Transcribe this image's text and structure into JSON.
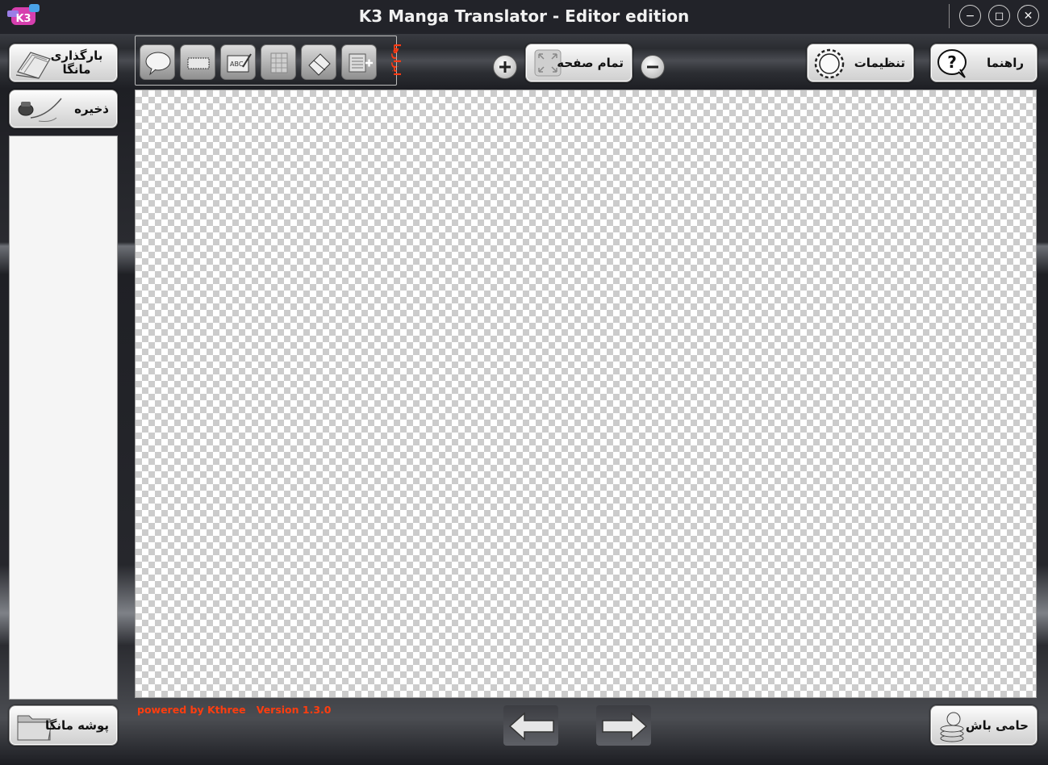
{
  "window": {
    "title": "K3 Manga Translator - Editor edition",
    "controls": {
      "minimize": "−",
      "maximize": "◻",
      "close": "✕"
    }
  },
  "left_panel": {
    "load_manga": "بارگذاری مانگا",
    "save": "ذخیره",
    "manga_folder": "پوشه مانگا"
  },
  "toolbar": {
    "tools_label": "ابزارها",
    "tools": [
      "speech-bubble-icon",
      "text-box-icon",
      "text-edit-icon",
      "grid-icon",
      "eraser-icon",
      "add-text-block-icon"
    ]
  },
  "zoom": {
    "zoom_in": "+",
    "fullscreen_label": "تمام صفحه",
    "zoom_out": "−"
  },
  "top_right": {
    "settings": "تنظیمات",
    "help": "راهنما"
  },
  "footer": {
    "powered_by": "powered by Kthree",
    "version": "Version 1.3.0",
    "support": "حامی باش"
  },
  "colors": {
    "accent_orange": "#ff3d0f",
    "titlebar": "#222329",
    "canvas_checker": "#cccccc"
  }
}
